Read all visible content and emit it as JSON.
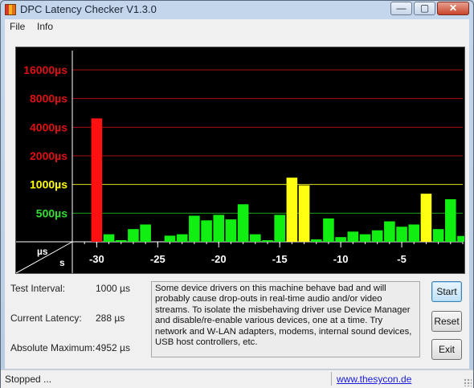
{
  "window": {
    "title": "DPC Latency Checker V1.3.0",
    "controls": {
      "minimize": "—",
      "maximize": "▢",
      "close": "✕"
    }
  },
  "menu": [
    "File",
    "Info"
  ],
  "chart_data": {
    "type": "bar",
    "y_axis_labels": [
      {
        "label": "16000µs",
        "value": 16000,
        "color": "#dd1111"
      },
      {
        "label": "8000µs",
        "value": 8000,
        "color": "#dd1111"
      },
      {
        "label": "4000µs",
        "value": 4000,
        "color": "#dd1111"
      },
      {
        "label": "2000µs",
        "value": 2000,
        "color": "#dd1111"
      },
      {
        "label": "1000µs",
        "value": 1000,
        "color": "#ffff00"
      },
      {
        "label": "500µs",
        "value": 500,
        "color": "#33dd33"
      }
    ],
    "corner_labels": {
      "unit_y": "µs",
      "unit_x": "s"
    },
    "x_tick_labels": [
      {
        "label": "-30",
        "value": -30
      },
      {
        "label": "-25",
        "value": -25
      },
      {
        "label": "-20",
        "value": -20
      },
      {
        "label": "-15",
        "value": -15
      },
      {
        "label": "-10",
        "value": -10
      },
      {
        "label": "-5",
        "value": -5
      }
    ],
    "xlim": [
      -32,
      0
    ],
    "x": [
      -30,
      -29,
      -28,
      -27,
      -26,
      -25,
      -24,
      -23,
      -22,
      -21,
      -20,
      -19,
      -18,
      -17,
      -16,
      -15,
      -14,
      -13,
      -12,
      -11,
      -10,
      -9,
      -8,
      -7,
      -6,
      -5,
      -4,
      -3,
      -2,
      -1,
      0
    ],
    "values": [
      4952,
      300,
      260,
      340,
      380,
      245,
      290,
      300,
      470,
      420,
      480,
      430,
      620,
      300,
      260,
      480,
      1180,
      980,
      265,
      440,
      280,
      320,
      300,
      330,
      410,
      360,
      380,
      800,
      340,
      700,
      288
    ],
    "colors": {
      "green": "#11ee11",
      "yellow": "#ffff11",
      "red": "#ff1111"
    },
    "thresholds": {
      "yellow": 750,
      "red": 2000
    }
  },
  "info": {
    "test_interval_label": "Test Interval:",
    "test_interval_value": "1000 µs",
    "current_latency_label": "Current Latency:",
    "current_latency_value": "288 µs",
    "absolute_maximum_label": "Absolute Maximum:",
    "absolute_maximum_value": "4952 µs"
  },
  "description": "Some device drivers on this machine behave bad and will probably cause drop-outs in real-time audio and/or video streams. To isolate the misbehaving driver use Device Manager and disable/re-enable various devices, one at a time. Try network and W-LAN adapters, modems, internal sound devices, USB host controllers, etc.",
  "buttons": {
    "start": "Start",
    "reset": "Reset",
    "exit": "Exit"
  },
  "status": {
    "text": "Stopped ...",
    "link": "www.thesycon.de"
  }
}
